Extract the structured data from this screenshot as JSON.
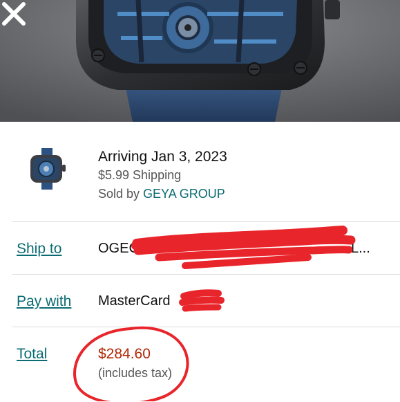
{
  "hero": {
    "close_icon": "close-x-icon",
    "image": "watch-product-image"
  },
  "item": {
    "arriving": "Arriving Jan 3, 2023",
    "shipping": "$5.99 Shipping",
    "sold_by_prefix": "Sold by ",
    "seller": "GEYA GROUP",
    "thumbnail": "watch-thumbnail"
  },
  "ship_to": {
    "label": "Ship to",
    "value": "OGECHI",
    "suffix": "L..."
  },
  "pay_with": {
    "label": "Pay with",
    "value": "MasterCard"
  },
  "total": {
    "label": "Total",
    "amount": "$284.60",
    "note": "(includes tax)"
  },
  "colors": {
    "link": "#0a6b73",
    "price": "#b12704",
    "redaction": "#e8252b"
  }
}
